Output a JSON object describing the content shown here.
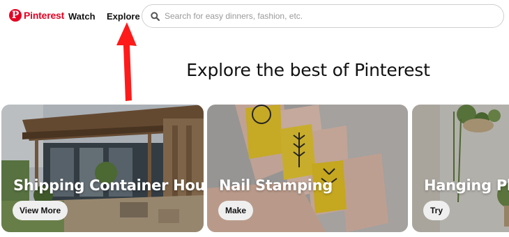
{
  "header": {
    "logo_text": "Pinterest",
    "logo_letter": "P",
    "nav": {
      "watch": "Watch",
      "explore": "Explore"
    },
    "search": {
      "placeholder": "Search for easy dinners, fashion, etc.",
      "value": ""
    }
  },
  "annotation": {
    "arrow_color": "#ff1a1a",
    "points_to": "Explore"
  },
  "main": {
    "heading": "Explore the best of Pinterest",
    "cards": [
      {
        "title": "Shipping Container House",
        "button": "View More"
      },
      {
        "title": "Nail Stamping",
        "button": "Make"
      },
      {
        "title": "Hanging Plants",
        "button": "Try"
      }
    ]
  },
  "colors": {
    "brand": "#e60023",
    "button_bg": "#efefef"
  }
}
